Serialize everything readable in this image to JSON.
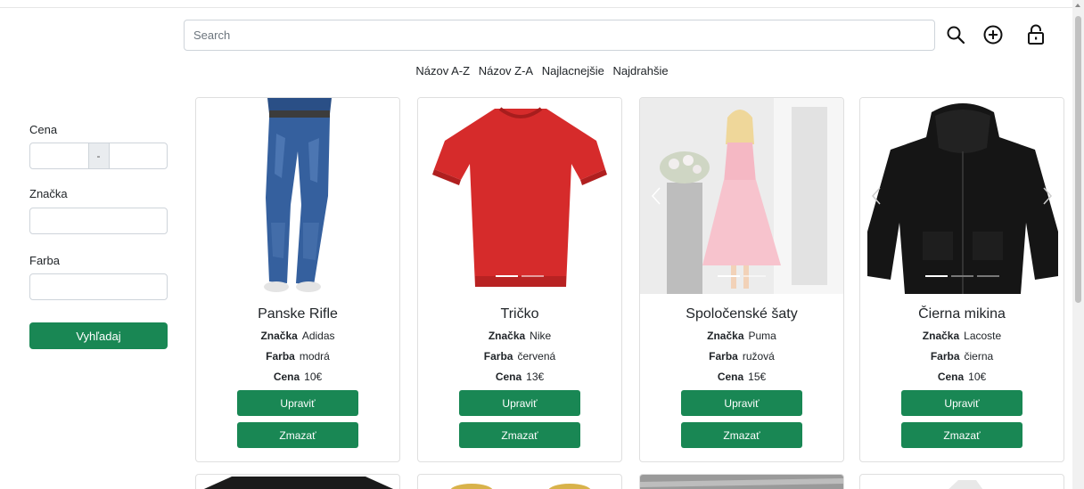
{
  "header": {
    "search_placeholder": "Search",
    "icons": [
      "search-icon",
      "add-circle-icon",
      "lock-icon"
    ]
  },
  "sort": {
    "options": [
      "Názov A-Z",
      "Názov Z-A",
      "Najlacnejšie",
      "Najdrahšie"
    ]
  },
  "sidebar": {
    "price_label": "Cena",
    "price_separator": "-",
    "brand_label": "Značka",
    "color_label": "Farba",
    "search_button": "Vyhľadaj"
  },
  "labels": {
    "brand": "Značka",
    "color": "Farba",
    "price": "Cena",
    "edit": "Upraviť",
    "delete": "Zmazať"
  },
  "products": [
    {
      "name": "Panske Rifle",
      "brand": "Adidas",
      "color": "modrá",
      "price": "10€"
    },
    {
      "name": "Tričko",
      "brand": "Nike",
      "color": "červená",
      "price": "13€"
    },
    {
      "name": "Spoločenské šaty",
      "brand": "Puma",
      "color": "ružová",
      "price": "15€"
    },
    {
      "name": "Čierna mikina",
      "brand": "Lacoste",
      "color": "čierna",
      "price": "10€"
    }
  ],
  "colors": {
    "accent": "#198754",
    "border": "#dfdfdf"
  }
}
